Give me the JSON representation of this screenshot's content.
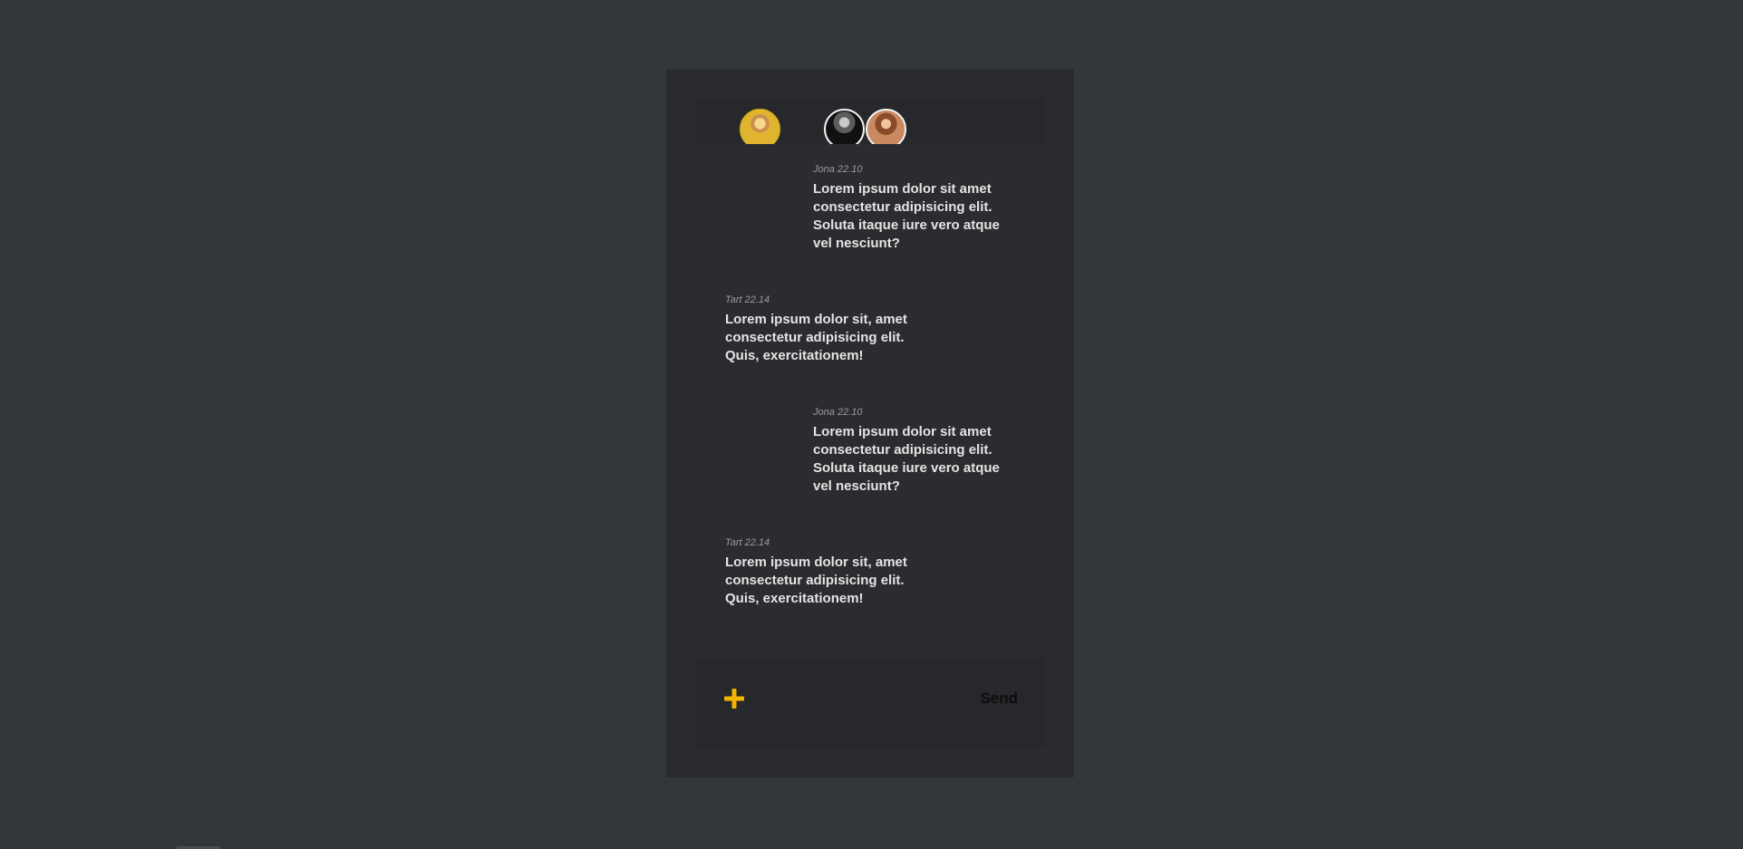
{
  "chat": {
    "avatars": {
      "me": "profile-avatar",
      "participants": [
        "participant-avatar-1",
        "participant-avatar-2"
      ]
    },
    "messages": [
      {
        "author": "Jona",
        "time": "22.10",
        "text": "Lorem ipsum dolor sit amet consectetur adipisicing elit. Soluta itaque iure vero atque vel nesciunt?"
      },
      {
        "author": "Tart",
        "time": "22.14",
        "text": "Lorem ipsum dolor sit, amet consectetur adipisicing elit. Quis, exercitationem!"
      },
      {
        "author": "Jona",
        "time": "22.10",
        "text": "Lorem ipsum dolor sit amet consectetur adipisicing elit. Soluta itaque iure vero atque vel nesciunt?"
      },
      {
        "author": "Tart",
        "time": "22.14",
        "text": "Lorem ipsum dolor sit, amet consectetur adipisicing elit. Quis, exercitationem!"
      }
    ],
    "composer": {
      "add_icon": "plus-icon",
      "send_label": "Send"
    },
    "colors": {
      "accent": "#f5b400",
      "background": "#33363b",
      "panel": "#2a2b2e"
    }
  }
}
